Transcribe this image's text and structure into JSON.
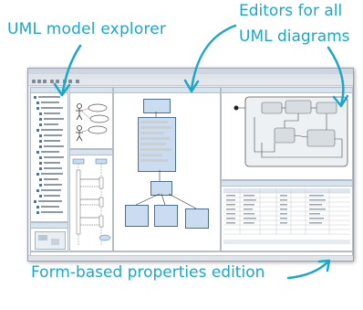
{
  "annotations": {
    "model_explorer": "UML model explorer",
    "editors_line1": "Editors for all",
    "editors_line2": "UML diagrams",
    "properties": "Form-based properties edition"
  },
  "colors": {
    "annotation": "#1aa7c9",
    "panel_header": "#d7e3ef",
    "uml_class_fill": "#c9dcf0"
  }
}
